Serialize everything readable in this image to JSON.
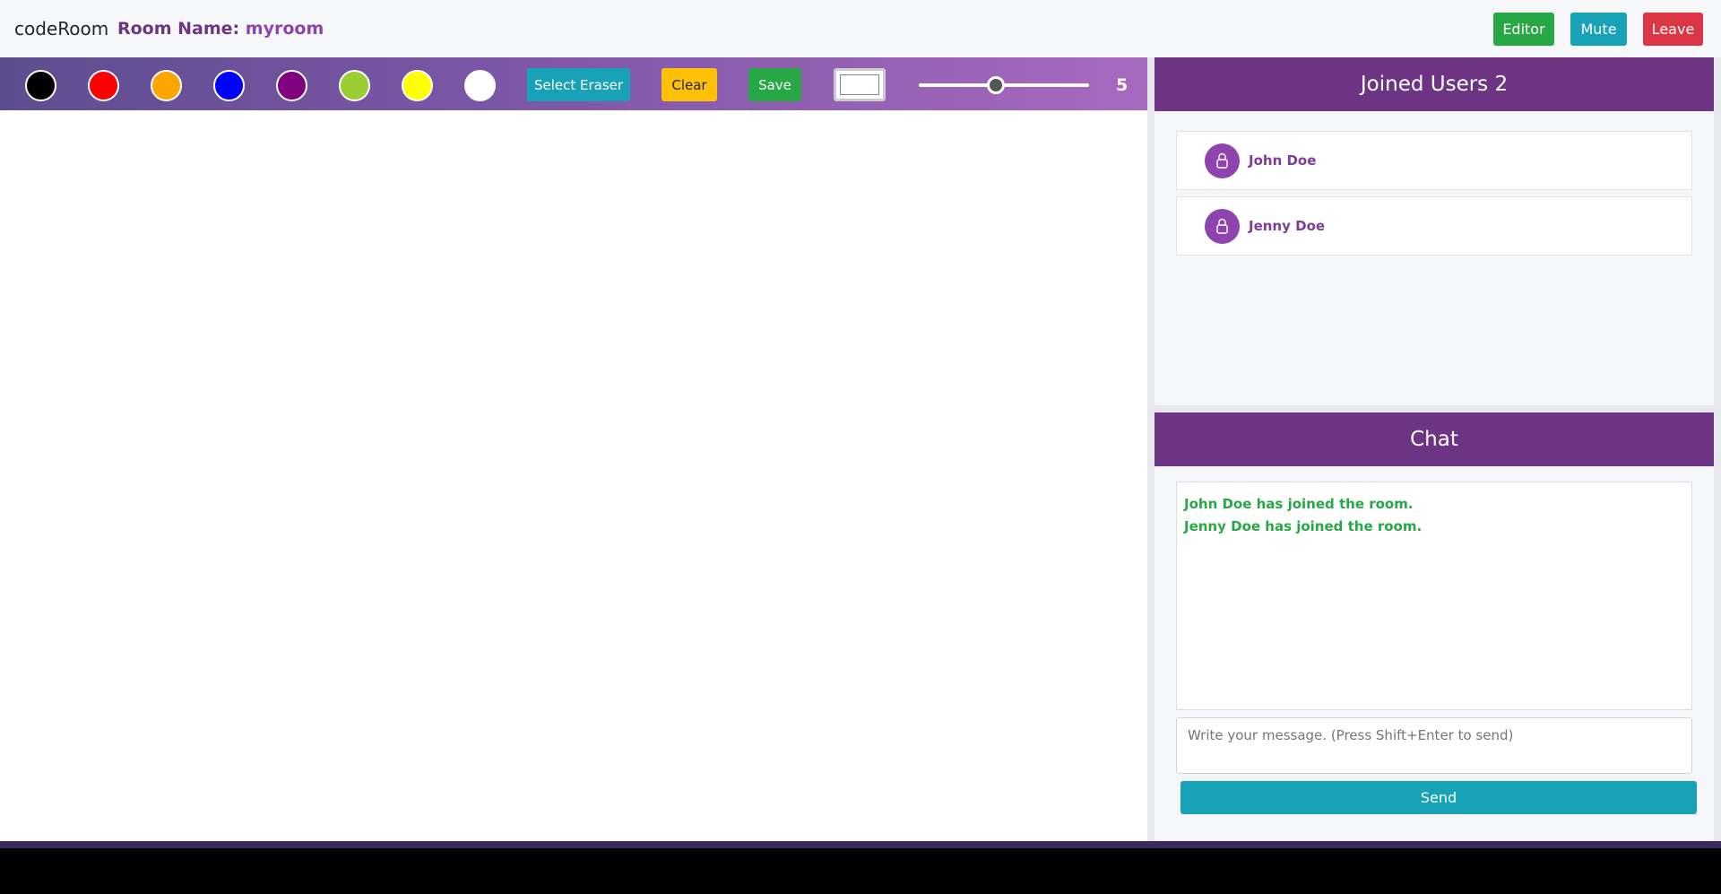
{
  "navbar": {
    "brand": "codeRoom",
    "room_label": "Room Name:",
    "room_name": "myroom",
    "buttons": {
      "editor": "Editor",
      "mute": "Mute",
      "leave": "Leave"
    }
  },
  "toolbar": {
    "swatches": [
      {
        "color": "#000000",
        "name": "black"
      },
      {
        "color": "#ff0000",
        "name": "red"
      },
      {
        "color": "#ffa500",
        "name": "orange"
      },
      {
        "color": "#0000ff",
        "name": "blue"
      },
      {
        "color": "#800080",
        "name": "purple"
      },
      {
        "color": "#9acd32",
        "name": "yellowgreen"
      },
      {
        "color": "#ffff00",
        "name": "yellow"
      },
      {
        "color": "#ffffff",
        "name": "white"
      }
    ],
    "eraser_label": "Select Eraser",
    "clear_label": "Clear",
    "save_label": "Save",
    "selected_color": "#ffffff",
    "brush_size": "5",
    "brush_size_fraction": 0.45
  },
  "users": {
    "title": "Joined Users 2",
    "list": [
      {
        "name": "John Doe"
      },
      {
        "name": "Jenny Doe"
      }
    ]
  },
  "chat": {
    "title": "Chat",
    "messages": [
      "John Doe has joined the room.",
      "Jenny Doe has joined the room."
    ],
    "placeholder": "Write your message. (Press Shift+Enter to send)",
    "send_label": "Send"
  },
  "colors": {
    "accent_purple": "#6c3483",
    "success": "#28a745",
    "info": "#17a2b8",
    "danger": "#dc3545",
    "warning": "#ffc107"
  }
}
